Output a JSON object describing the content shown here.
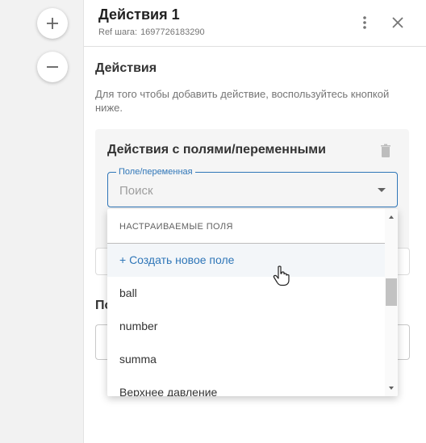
{
  "canvas": {
    "zoom_in_icon": "plus-icon",
    "zoom_out_icon": "minus-icon"
  },
  "panel": {
    "title": "Действия 1",
    "ref_label": "Ref шага:",
    "ref_value": "1697726183290",
    "more_icon": "more-vert-icon",
    "close_icon": "close-icon"
  },
  "actions": {
    "section_title": "Действия",
    "hint": "Для того чтобы добавить действие, воспользуйтесь кнопкой ниже.",
    "card": {
      "title": "Действия с полями/переменными",
      "delete_icon": "trash-icon",
      "field_label": "Поле/переменная",
      "placeholder": "Поиск"
    }
  },
  "dropdown": {
    "group_header": "НАСТРАИВАЕМЫЕ ПОЛЯ",
    "create_label": "+ Создать новое поле",
    "items": [
      "ball",
      "number",
      "summa",
      "Верхнее давление"
    ]
  },
  "background_fragments": {
    "section_title_fragment": "По"
  },
  "colors": {
    "accent": "#2f76b8",
    "card_bg": "#f5f5f5",
    "canvas_bg": "#f2f2f2"
  }
}
